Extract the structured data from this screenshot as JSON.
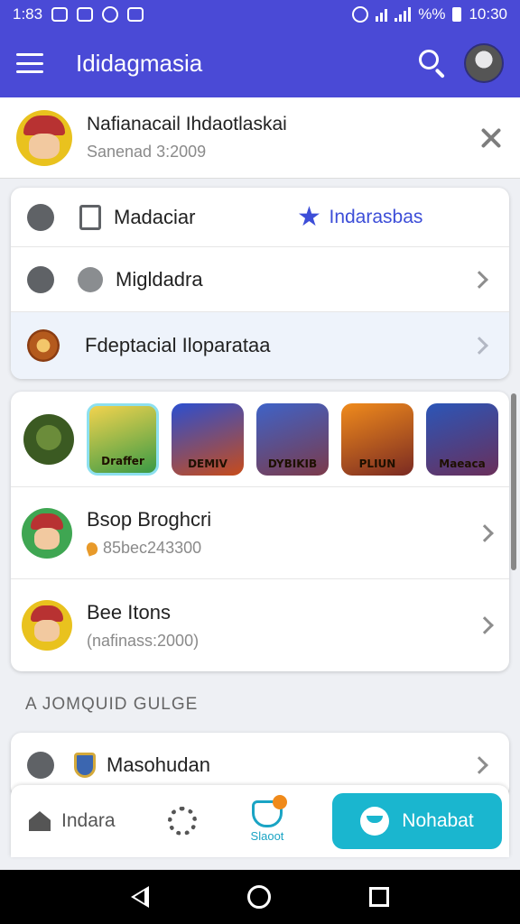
{
  "status_bar": {
    "time": "1:83",
    "battery_pct": "%%",
    "clock": "10:30"
  },
  "app_bar": {
    "title": "Ididagmasia"
  },
  "notification": {
    "title": "Nafianacail Ihdaotlaskai",
    "subtitle": "Sanenad 3:2009"
  },
  "menu": {
    "items": [
      {
        "label": "Madaciar",
        "extra": "Indarasbas"
      },
      {
        "label": "Migldadra"
      },
      {
        "label": "Fdeptacial Iloparataa"
      }
    ]
  },
  "games": {
    "tiles": [
      {
        "label": "Draffer",
        "colors": [
          "#f2d34e",
          "#3a9a45"
        ]
      },
      {
        "label": "DEMIV",
        "colors": [
          "#2b4fd0",
          "#c84c1a"
        ]
      },
      {
        "label": "DYBIKIB",
        "colors": [
          "#3e63c8",
          "#7c3a4a"
        ]
      },
      {
        "label": "PLIUN",
        "colors": [
          "#f08b1c",
          "#7a2a22"
        ]
      },
      {
        "label": "Maeaca",
        "colors": [
          "#2b56b8",
          "#6a2f5a"
        ]
      }
    ]
  },
  "players": [
    {
      "name": "Bsop Broghcri",
      "sub": "85bec243300",
      "avatar_bg": "#3fa652",
      "has_flame": true
    },
    {
      "name": "Bee Itons",
      "sub": "(nafinass:2000)",
      "avatar_bg": "#e9c21e",
      "has_flame": false
    }
  ],
  "section": {
    "label": "A JOMQUID GULGE"
  },
  "list": {
    "item_label": "Masohudan"
  },
  "bottom_nav": {
    "home_label": "Indara",
    "mid_label": "Slaoot",
    "cta_label": "Nohabat"
  }
}
